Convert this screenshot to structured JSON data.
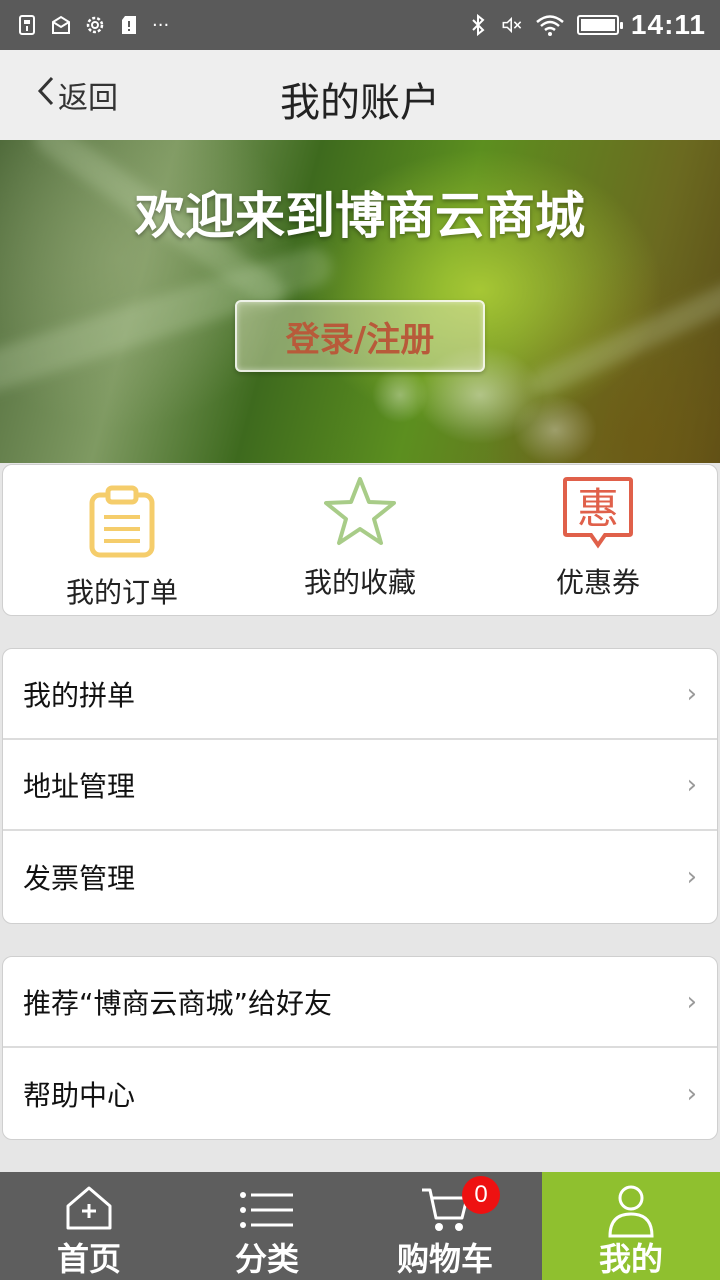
{
  "status_bar": {
    "time": "14:11",
    "left_icons": [
      "usb-icon",
      "mail-box-icon",
      "gear-icon",
      "sd-card-icon",
      "more-dots-icon"
    ],
    "right_icons": [
      "bluetooth-icon",
      "mute-icon",
      "wifi-icon",
      "battery-icon"
    ],
    "more_dots": "···",
    "battery_level": 1.0
  },
  "header": {
    "back_label": "返回",
    "title": "我的账户"
  },
  "banner": {
    "welcome": "欢迎来到博商云商城",
    "login_label": "登录/注册"
  },
  "quick_actions": [
    {
      "label": "我的订单",
      "icon": "clipboard-icon",
      "color": "#f5cd6b"
    },
    {
      "label": "我的收藏",
      "icon": "star-icon",
      "color": "#a8cc88"
    },
    {
      "label": "优惠券",
      "icon": "coupon-hui-icon",
      "color": "#e0604a",
      "glyph": "惠"
    }
  ],
  "menu_group_1": [
    {
      "label": "我的拼单"
    },
    {
      "label": "地址管理"
    },
    {
      "label": "发票管理"
    }
  ],
  "menu_group_2": [
    {
      "label": "推荐“博商云商城”给好友"
    },
    {
      "label": "帮助中心"
    }
  ],
  "chevron": "›",
  "bottom_nav": [
    {
      "label": "首页",
      "icon": "home-icon"
    },
    {
      "label": "分类",
      "icon": "list-icon"
    },
    {
      "label": "购物车",
      "icon": "cart-icon",
      "badge": "0"
    },
    {
      "label": "我的",
      "icon": "user-icon",
      "active": true
    }
  ],
  "colors": {
    "active_nav": "#8fc02f",
    "nav_bg": "#5e5e5e",
    "badge": "#ee1111",
    "login_text": "#b85a3a"
  }
}
